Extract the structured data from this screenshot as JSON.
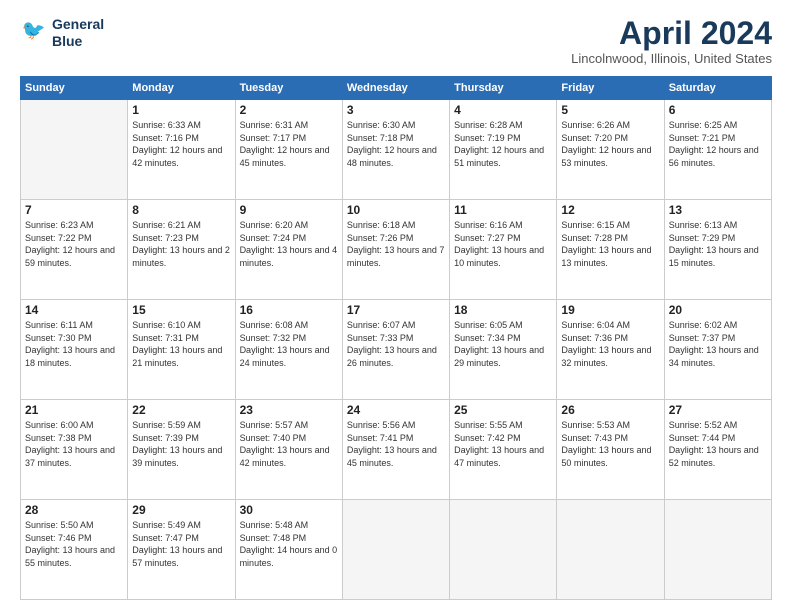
{
  "header": {
    "logo_line1": "General",
    "logo_line2": "Blue",
    "month_title": "April 2024",
    "location": "Lincolnwood, Illinois, United States"
  },
  "weekdays": [
    "Sunday",
    "Monday",
    "Tuesday",
    "Wednesday",
    "Thursday",
    "Friday",
    "Saturday"
  ],
  "weeks": [
    [
      {
        "day": "",
        "sunrise": "",
        "sunset": "",
        "daylight": ""
      },
      {
        "day": "1",
        "sunrise": "Sunrise: 6:33 AM",
        "sunset": "Sunset: 7:16 PM",
        "daylight": "Daylight: 12 hours and 42 minutes."
      },
      {
        "day": "2",
        "sunrise": "Sunrise: 6:31 AM",
        "sunset": "Sunset: 7:17 PM",
        "daylight": "Daylight: 12 hours and 45 minutes."
      },
      {
        "day": "3",
        "sunrise": "Sunrise: 6:30 AM",
        "sunset": "Sunset: 7:18 PM",
        "daylight": "Daylight: 12 hours and 48 minutes."
      },
      {
        "day": "4",
        "sunrise": "Sunrise: 6:28 AM",
        "sunset": "Sunset: 7:19 PM",
        "daylight": "Daylight: 12 hours and 51 minutes."
      },
      {
        "day": "5",
        "sunrise": "Sunrise: 6:26 AM",
        "sunset": "Sunset: 7:20 PM",
        "daylight": "Daylight: 12 hours and 53 minutes."
      },
      {
        "day": "6",
        "sunrise": "Sunrise: 6:25 AM",
        "sunset": "Sunset: 7:21 PM",
        "daylight": "Daylight: 12 hours and 56 minutes."
      }
    ],
    [
      {
        "day": "7",
        "sunrise": "Sunrise: 6:23 AM",
        "sunset": "Sunset: 7:22 PM",
        "daylight": "Daylight: 12 hours and 59 minutes."
      },
      {
        "day": "8",
        "sunrise": "Sunrise: 6:21 AM",
        "sunset": "Sunset: 7:23 PM",
        "daylight": "Daylight: 13 hours and 2 minutes."
      },
      {
        "day": "9",
        "sunrise": "Sunrise: 6:20 AM",
        "sunset": "Sunset: 7:24 PM",
        "daylight": "Daylight: 13 hours and 4 minutes."
      },
      {
        "day": "10",
        "sunrise": "Sunrise: 6:18 AM",
        "sunset": "Sunset: 7:26 PM",
        "daylight": "Daylight: 13 hours and 7 minutes."
      },
      {
        "day": "11",
        "sunrise": "Sunrise: 6:16 AM",
        "sunset": "Sunset: 7:27 PM",
        "daylight": "Daylight: 13 hours and 10 minutes."
      },
      {
        "day": "12",
        "sunrise": "Sunrise: 6:15 AM",
        "sunset": "Sunset: 7:28 PM",
        "daylight": "Daylight: 13 hours and 13 minutes."
      },
      {
        "day": "13",
        "sunrise": "Sunrise: 6:13 AM",
        "sunset": "Sunset: 7:29 PM",
        "daylight": "Daylight: 13 hours and 15 minutes."
      }
    ],
    [
      {
        "day": "14",
        "sunrise": "Sunrise: 6:11 AM",
        "sunset": "Sunset: 7:30 PM",
        "daylight": "Daylight: 13 hours and 18 minutes."
      },
      {
        "day": "15",
        "sunrise": "Sunrise: 6:10 AM",
        "sunset": "Sunset: 7:31 PM",
        "daylight": "Daylight: 13 hours and 21 minutes."
      },
      {
        "day": "16",
        "sunrise": "Sunrise: 6:08 AM",
        "sunset": "Sunset: 7:32 PM",
        "daylight": "Daylight: 13 hours and 24 minutes."
      },
      {
        "day": "17",
        "sunrise": "Sunrise: 6:07 AM",
        "sunset": "Sunset: 7:33 PM",
        "daylight": "Daylight: 13 hours and 26 minutes."
      },
      {
        "day": "18",
        "sunrise": "Sunrise: 6:05 AM",
        "sunset": "Sunset: 7:34 PM",
        "daylight": "Daylight: 13 hours and 29 minutes."
      },
      {
        "day": "19",
        "sunrise": "Sunrise: 6:04 AM",
        "sunset": "Sunset: 7:36 PM",
        "daylight": "Daylight: 13 hours and 32 minutes."
      },
      {
        "day": "20",
        "sunrise": "Sunrise: 6:02 AM",
        "sunset": "Sunset: 7:37 PM",
        "daylight": "Daylight: 13 hours and 34 minutes."
      }
    ],
    [
      {
        "day": "21",
        "sunrise": "Sunrise: 6:00 AM",
        "sunset": "Sunset: 7:38 PM",
        "daylight": "Daylight: 13 hours and 37 minutes."
      },
      {
        "day": "22",
        "sunrise": "Sunrise: 5:59 AM",
        "sunset": "Sunset: 7:39 PM",
        "daylight": "Daylight: 13 hours and 39 minutes."
      },
      {
        "day": "23",
        "sunrise": "Sunrise: 5:57 AM",
        "sunset": "Sunset: 7:40 PM",
        "daylight": "Daylight: 13 hours and 42 minutes."
      },
      {
        "day": "24",
        "sunrise": "Sunrise: 5:56 AM",
        "sunset": "Sunset: 7:41 PM",
        "daylight": "Daylight: 13 hours and 45 minutes."
      },
      {
        "day": "25",
        "sunrise": "Sunrise: 5:55 AM",
        "sunset": "Sunset: 7:42 PM",
        "daylight": "Daylight: 13 hours and 47 minutes."
      },
      {
        "day": "26",
        "sunrise": "Sunrise: 5:53 AM",
        "sunset": "Sunset: 7:43 PM",
        "daylight": "Daylight: 13 hours and 50 minutes."
      },
      {
        "day": "27",
        "sunrise": "Sunrise: 5:52 AM",
        "sunset": "Sunset: 7:44 PM",
        "daylight": "Daylight: 13 hours and 52 minutes."
      }
    ],
    [
      {
        "day": "28",
        "sunrise": "Sunrise: 5:50 AM",
        "sunset": "Sunset: 7:46 PM",
        "daylight": "Daylight: 13 hours and 55 minutes."
      },
      {
        "day": "29",
        "sunrise": "Sunrise: 5:49 AM",
        "sunset": "Sunset: 7:47 PM",
        "daylight": "Daylight: 13 hours and 57 minutes."
      },
      {
        "day": "30",
        "sunrise": "Sunrise: 5:48 AM",
        "sunset": "Sunset: 7:48 PM",
        "daylight": "Daylight: 14 hours and 0 minutes."
      },
      {
        "day": "",
        "sunrise": "",
        "sunset": "",
        "daylight": ""
      },
      {
        "day": "",
        "sunrise": "",
        "sunset": "",
        "daylight": ""
      },
      {
        "day": "",
        "sunrise": "",
        "sunset": "",
        "daylight": ""
      },
      {
        "day": "",
        "sunrise": "",
        "sunset": "",
        "daylight": ""
      }
    ]
  ]
}
